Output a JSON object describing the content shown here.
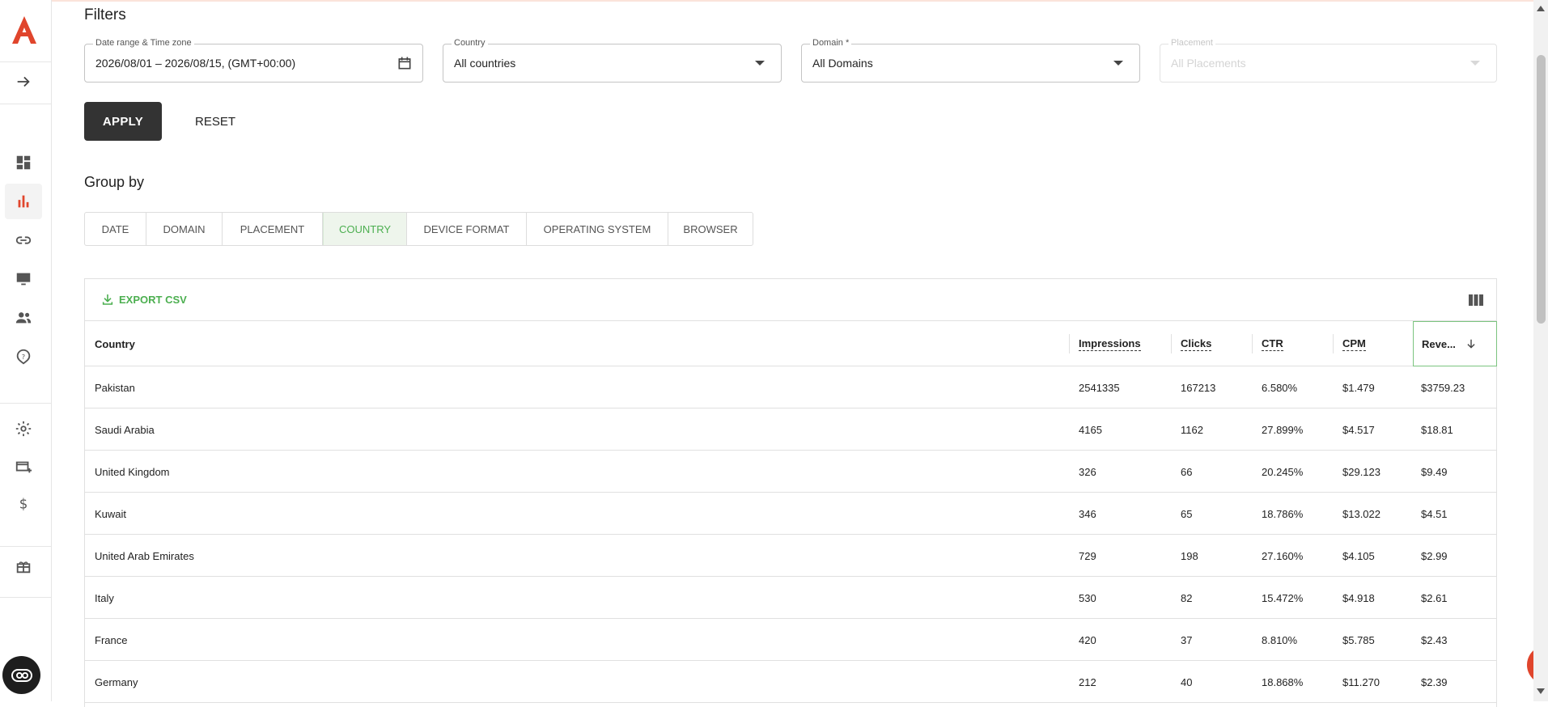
{
  "colors": {
    "accent": "#4caf50",
    "brand": "#e0452c",
    "apply_bg": "#333333"
  },
  "sidebar": {
    "items": [
      {
        "icon": "arrow-right-icon"
      },
      {
        "icon": "dashboard-icon"
      },
      {
        "icon": "bar-chart-icon",
        "active": true
      },
      {
        "icon": "link-icon"
      },
      {
        "icon": "monitor-icon"
      },
      {
        "icon": "users-icon"
      },
      {
        "icon": "help-icon"
      },
      {
        "icon": "gear-icon"
      },
      {
        "icon": "add-card-icon"
      },
      {
        "icon": "dollar-icon"
      },
      {
        "icon": "gift-icon"
      }
    ]
  },
  "filters": {
    "title": "Filters",
    "date": {
      "label": "Date range & Time zone",
      "value": "2026/08/01 – 2026/08/15, (GMT+00:00)"
    },
    "country": {
      "label": "Country",
      "value": "All countries"
    },
    "domain": {
      "label": "Domain *",
      "value": "All Domains"
    },
    "placement": {
      "label": "Placement",
      "value": "All Placements"
    },
    "apply_label": "APPLY",
    "reset_label": "RESET"
  },
  "group_by": {
    "title": "Group by",
    "tabs": [
      {
        "label": "DATE"
      },
      {
        "label": "DOMAIN"
      },
      {
        "label": "PLACEMENT"
      },
      {
        "label": "COUNTRY",
        "active": true
      },
      {
        "label": "DEVICE FORMAT"
      },
      {
        "label": "OPERATING SYSTEM"
      },
      {
        "label": "BROWSER"
      }
    ]
  },
  "table": {
    "export_label": "EXPORT CSV",
    "columns": [
      "Country",
      "Impressions",
      "Clicks",
      "CTR",
      "CPM",
      "Reve..."
    ],
    "rows": [
      [
        "Pakistan",
        "2541335",
        "167213",
        "6.580%",
        "$1.479",
        "$3759.23"
      ],
      [
        "Saudi Arabia",
        "4165",
        "1162",
        "27.899%",
        "$4.517",
        "$18.81"
      ],
      [
        "United Kingdom",
        "326",
        "66",
        "20.245%",
        "$29.123",
        "$9.49"
      ],
      [
        "Kuwait",
        "346",
        "65",
        "18.786%",
        "$13.022",
        "$4.51"
      ],
      [
        "United Arab Emirates",
        "729",
        "198",
        "27.160%",
        "$4.105",
        "$2.99"
      ],
      [
        "Italy",
        "530",
        "82",
        "15.472%",
        "$4.918",
        "$2.61"
      ],
      [
        "France",
        "420",
        "37",
        "8.810%",
        "$5.785",
        "$2.43"
      ],
      [
        "Germany",
        "212",
        "40",
        "18.868%",
        "$11.270",
        "$2.39"
      ]
    ]
  }
}
